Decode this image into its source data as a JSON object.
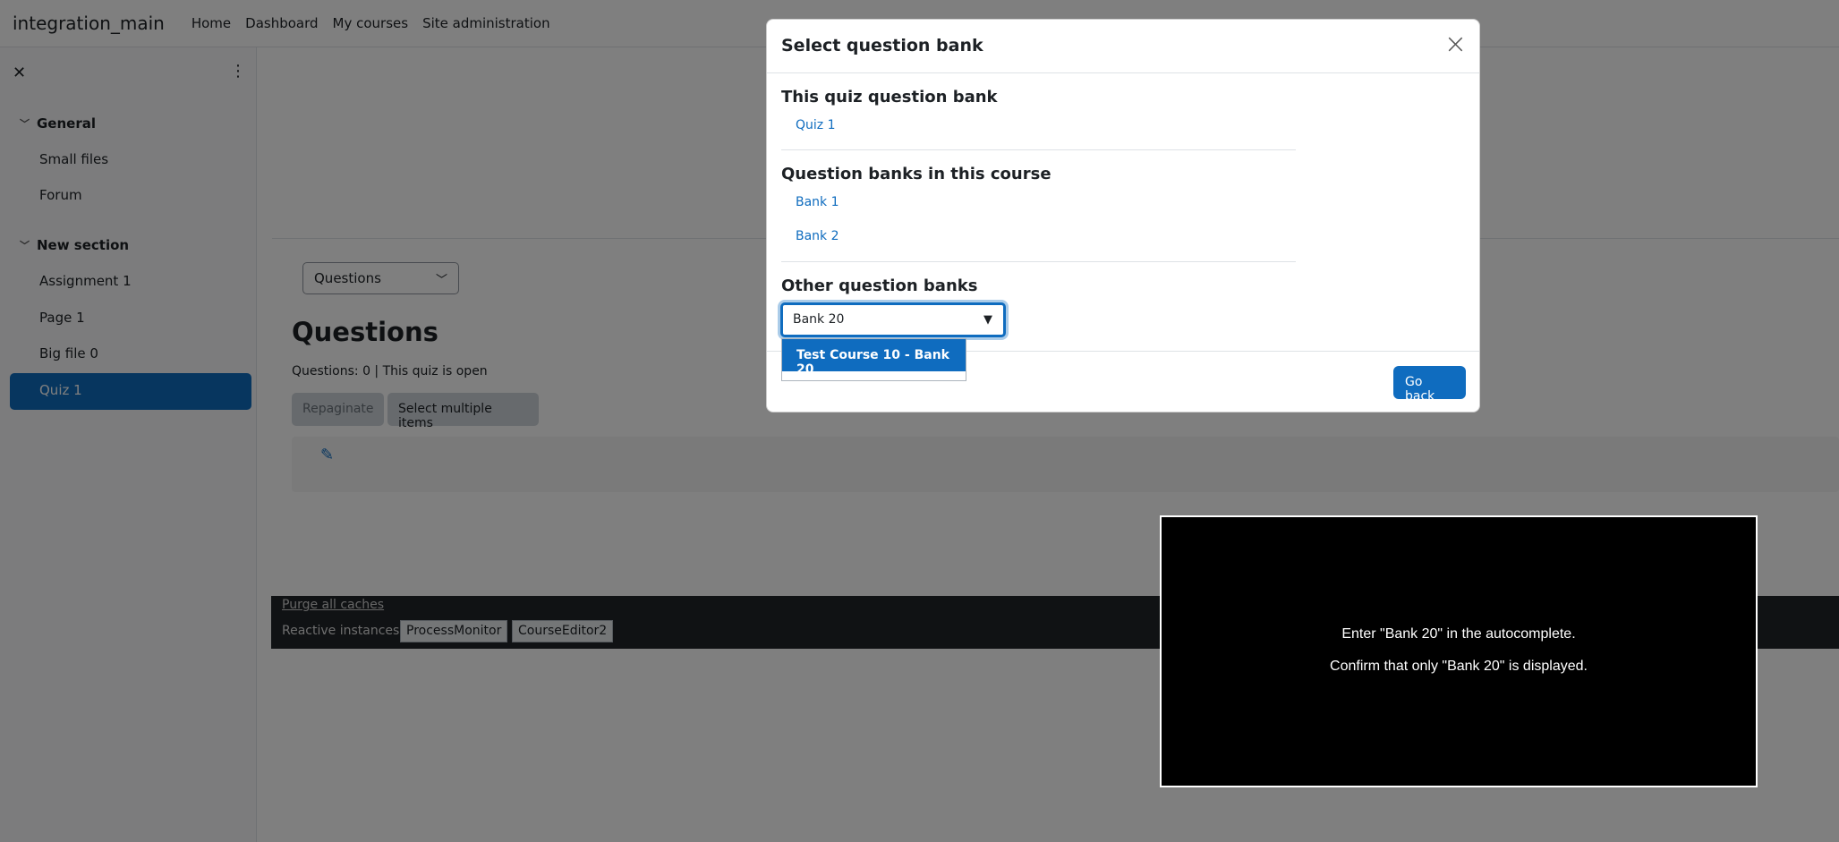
{
  "navbar": {
    "site_name": "integration_main",
    "links": [
      "Home",
      "Dashboard",
      "My courses",
      "Site administration"
    ]
  },
  "drawer": {
    "close_icon": "✕",
    "menu_icon": "⋮",
    "sections": [
      {
        "title": "General",
        "items": [
          "Small files",
          "Forum"
        ]
      },
      {
        "title": "New section",
        "items": [
          "Assignment 1",
          "Page 1",
          "Big file 0",
          "Quiz 1"
        ]
      }
    ],
    "active_item": "Quiz 1"
  },
  "main": {
    "select_value": "Questions",
    "heading": "Questions",
    "info": "Questions: 0 | This quiz is open",
    "repaginate_label": "Repaginate",
    "select_multiple_label": "Select multiple items"
  },
  "footer": {
    "purge_label": "Purge all caches",
    "reactive_label": "Reactive instances:",
    "instances": [
      "ProcessMonitor",
      "CourseEditor2"
    ]
  },
  "modal": {
    "title": "Select question bank",
    "quiz_bank_heading": "This quiz question bank",
    "quiz_bank_link": "Quiz 1",
    "course_banks_heading": "Question banks in this course",
    "course_banks": [
      "Bank 1",
      "Bank 2"
    ],
    "other_banks_heading": "Other question banks",
    "autocomplete_value": "Bank 20",
    "suggestion": "Test Course 10 - Bank 20",
    "go_back_label": "Go back"
  },
  "instructions": {
    "line1": "Enter \"Bank 20\" in the autocomplete.",
    "line2": "Confirm that only \"Bank 20\" is displayed."
  },
  "colors": {
    "primary": "#0f6cbf",
    "footer_bg": "#212529"
  }
}
